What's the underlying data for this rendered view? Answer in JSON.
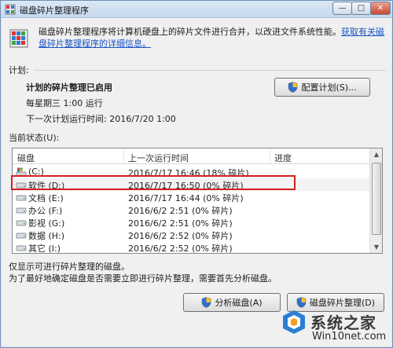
{
  "window": {
    "title": "磁盘碎片整理程序",
    "controls": {
      "minimize": "—",
      "maximize": "□",
      "close": "✕"
    }
  },
  "intro": {
    "text": "磁盘碎片整理程序将计算机硬盘上的碎片文件进行合并，以改进文件系统性能。",
    "link": "获取有关磁盘碎片整理程序的详细信息。"
  },
  "schedule": {
    "section_label": "计划:",
    "status": "计划的碎片整理已启用",
    "frequency": "每星期三  1:00 运行",
    "next_run": "下一次计划运行时间: 2016/7/20 1:00",
    "configure_button": "配置计划(S)..."
  },
  "status": {
    "section_label": "当前状态(U):",
    "columns": [
      "磁盘",
      "上一次运行时间",
      "进度"
    ],
    "rows": [
      {
        "disk": "(C:)",
        "last_run": "2016/7/17 16:46 (18% 碎片)",
        "progress": "",
        "icon": "system-drive-icon"
      },
      {
        "disk": "软件 (D:)",
        "last_run": "2016/7/17 16:50 (0% 碎片)",
        "progress": "",
        "icon": "drive-icon",
        "highlighted": true
      },
      {
        "disk": "文档 (E:)",
        "last_run": "2016/7/17 16:44 (0% 碎片)",
        "progress": "",
        "icon": "drive-icon"
      },
      {
        "disk": "办公 (F:)",
        "last_run": "2016/6/2 2:51 (0% 碎片)",
        "progress": "",
        "icon": "drive-icon"
      },
      {
        "disk": "影视 (G:)",
        "last_run": "2016/6/2 2:51 (0% 碎片)",
        "progress": "",
        "icon": "drive-icon"
      },
      {
        "disk": "数据 (H:)",
        "last_run": "2016/6/2 2:52 (0% 碎片)",
        "progress": "",
        "icon": "drive-icon"
      },
      {
        "disk": "其它 (I:)",
        "last_run": "2016/6/2 2:52 (0% 碎片)",
        "progress": "",
        "icon": "drive-icon"
      }
    ]
  },
  "notes": {
    "line1": "仅显示可进行碎片整理的磁盘。",
    "line2": "为了最好地确定磁盘是否需要立即进行碎片整理，需要首先分析磁盘。"
  },
  "actions": {
    "analyze_button": "分析磁盘(A)",
    "defrag_button": "磁盘碎片整理(D)"
  },
  "watermark": {
    "main": "系统之家",
    "sub": "Win10net.com"
  },
  "colors": {
    "link": "#1a55c5",
    "highlight_border": "#d42020",
    "titlebar": "#c6d9ef"
  }
}
